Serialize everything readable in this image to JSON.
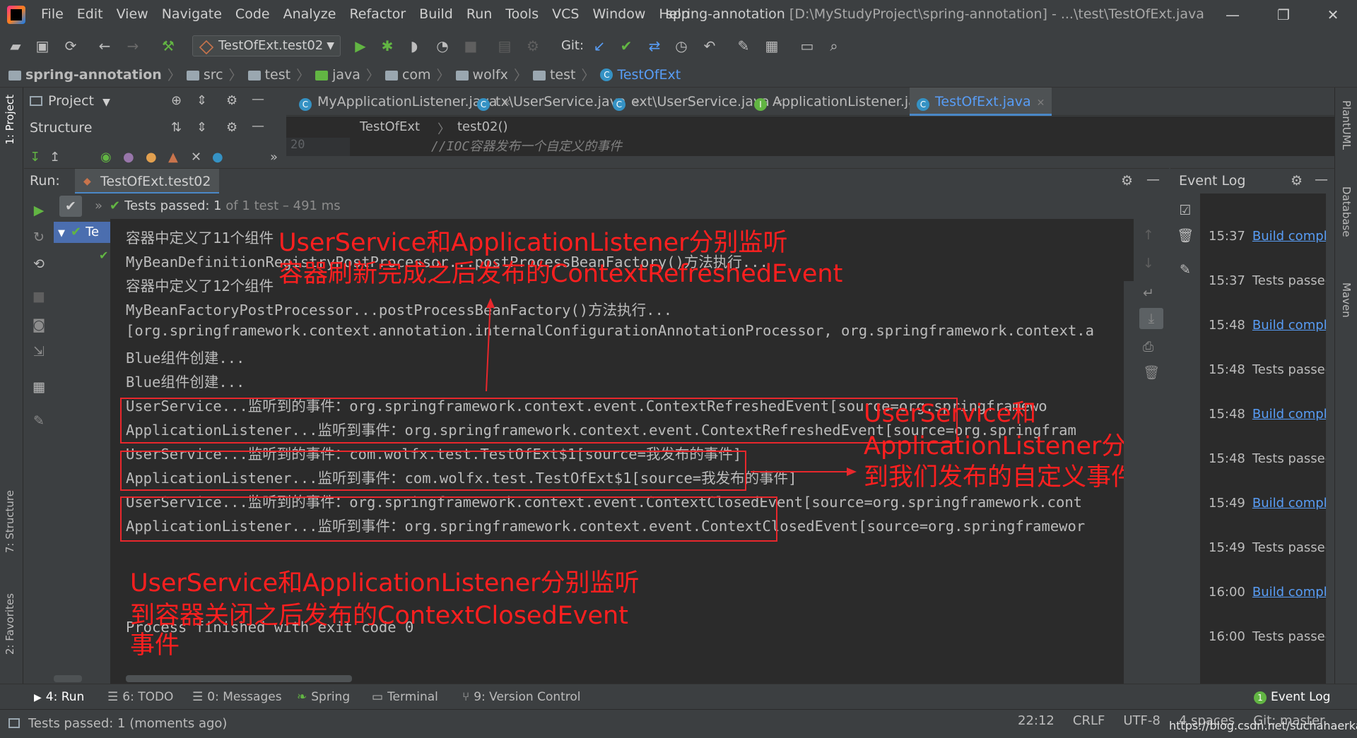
{
  "window": {
    "menu": [
      "File",
      "Edit",
      "View",
      "Navigate",
      "Code",
      "Analyze",
      "Refactor",
      "Build",
      "Run",
      "Tools",
      "VCS",
      "Window",
      "Help"
    ],
    "project_name": "spring-annotation",
    "title_path": "[D:\\MyStudyProject\\spring-annotation] - ...\\test\\TestOfExt.java",
    "controls": {
      "minimize": "—",
      "restore": "❐",
      "close": "✕"
    }
  },
  "toolbar": {
    "run_config": "TestOfExt.test02",
    "git_label": "Git:"
  },
  "breadcrumb": [
    "spring-annotation",
    "src",
    "test",
    "java",
    "com",
    "wolfx",
    "test",
    "TestOfExt"
  ],
  "side_strip": {
    "project": "1: Project",
    "structure": "7: Structure",
    "favorites": "2: Favorites",
    "plantuml": "PlantUML",
    "database": "Database",
    "maven": "Maven"
  },
  "side_pane": {
    "project_title": "Project",
    "structure_title": "Structure"
  },
  "editor": {
    "tabs": [
      {
        "label": "MyApplicationListener.java",
        "icon": "class-icon"
      },
      {
        "label": "tx\\UserService.java",
        "icon": "class-icon"
      },
      {
        "label": "ext\\UserService.java",
        "icon": "class-icon"
      },
      {
        "label": "ApplicationListener.java",
        "icon": "interface-icon"
      },
      {
        "label": "TestOfExt.java",
        "icon": "class-icon"
      }
    ],
    "crumb_class": "TestOfExt",
    "crumb_method": "test02()",
    "line_number": "20",
    "code_line": "//IOC容器发布一个自定义的事件"
  },
  "run": {
    "label": "Run:",
    "tab": "TestOfExt.test02",
    "tests_passed": "Tests passed:",
    "tests_count": "1",
    "tests_of": "of 1 test – 491 ms",
    "tree_item": "Te",
    "console_lines": [
      "容器中定义了11个组件",
      "MyBeanDefinitionRegistryPostProcessor...postProcessBeanFactory()方法执行...",
      "容器中定义了12个组件",
      "MyBeanFactoryPostProcessor...postProcessBeanFactory()方法执行...",
      "[org.springframework.context.annotation.internalConfigurationAnnotationProcessor, org.springframework.context.a",
      "Blue组件创建...",
      "Blue组件创建...",
      "UserService...监听到的事件：org.springframework.context.event.ContextRefreshedEvent[source=org.springframewo",
      "ApplicationListener...监听到事件：org.springframework.context.event.ContextRefreshedEvent[source=org.springfram",
      "UserService...监听到的事件：com.wolfx.test.TestOfExt$1[source=我发布的事件]",
      "ApplicationListener...监听到事件：com.wolfx.test.TestOfExt$1[source=我发布的事件]",
      "UserService...监听到的事件：org.springframework.context.event.ContextClosedEvent[source=org.springframework.cont",
      "ApplicationListener...监听到事件：org.springframework.context.event.ContextClosedEvent[source=org.springframewor",
      "",
      "",
      "Process finished with exit code 0"
    ]
  },
  "annotations": {
    "refreshed_1": "UserService和ApplicationListener分别监听",
    "refreshed_2": "容器刷新完成之后发布的ContextRefreshedEvent",
    "custom_1": "UserService和",
    "custom_2": "ApplicationListener分别监听",
    "custom_3": "到我们发布的自定义事件",
    "closed_1": "UserService和ApplicationListener分别监听",
    "closed_2": "到容器关闭之后发布的ContextClosedEvent",
    "closed_3": "事件",
    "color": "#ff1f1f"
  },
  "event_log": {
    "title": "Event Log",
    "entries": [
      {
        "time": "15:37",
        "text": "Build complet",
        "link": true
      },
      {
        "time": "15:37",
        "text": "Tests passed:",
        "link": false
      },
      {
        "time": "15:48",
        "text": "Build complet",
        "link": true
      },
      {
        "time": "15:48",
        "text": "Tests passed:",
        "link": false
      },
      {
        "time": "15:48",
        "text": "Build complet",
        "link": true
      },
      {
        "time": "15:48",
        "text": "Tests passed:",
        "link": false
      },
      {
        "time": "15:49",
        "text": "Build complet",
        "link": true
      },
      {
        "time": "15:49",
        "text": "Tests passed:",
        "link": false
      },
      {
        "time": "16:00",
        "text": "Build complet",
        "link": true
      },
      {
        "time": "16:00",
        "text": "Tests passed:",
        "link": false
      }
    ]
  },
  "bottom_tabs": [
    {
      "label": "4: Run",
      "icon": "play-icon"
    },
    {
      "label": "6: TODO",
      "icon": "list-icon"
    },
    {
      "label": "0: Messages",
      "icon": "messages-icon"
    },
    {
      "label": "Spring",
      "icon": "spring-icon"
    },
    {
      "label": "Terminal",
      "icon": "terminal-icon"
    },
    {
      "label": "9: Version Control",
      "icon": "vcs-icon"
    }
  ],
  "event_log_button": "Event Log",
  "event_log_badge": "1",
  "status": {
    "message": "Tests passed: 1 (moments ago)",
    "position": "22:12",
    "line_sep": "CRLF",
    "encoding": "UTF-8",
    "indent": "4 spaces",
    "git": "Git: master"
  },
  "watermark": "https://blog.csdn.net/suchahaerkang"
}
